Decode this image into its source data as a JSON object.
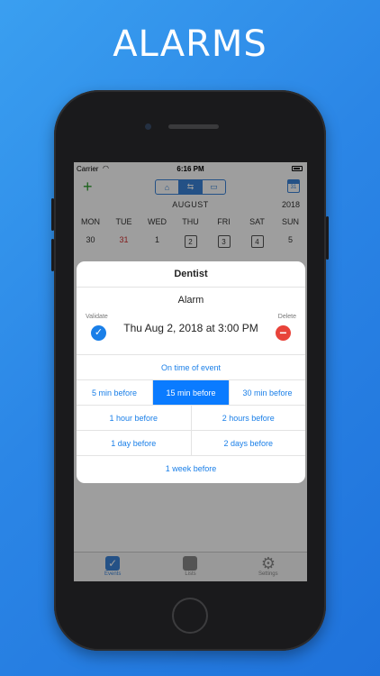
{
  "headline": "ALARMS",
  "status_bar": {
    "carrier": "Carrier",
    "time": "6:16 PM"
  },
  "nav": {
    "add_label": "+",
    "calendar_day": "31"
  },
  "calendar": {
    "month": "AUGUST",
    "year": "2018",
    "day_names": [
      "MON",
      "TUE",
      "WED",
      "THU",
      "FRI",
      "SAT",
      "SUN"
    ],
    "day_numbers": [
      "30",
      "31",
      "1",
      "2",
      "3",
      "4",
      "5"
    ]
  },
  "tabbar": {
    "events_label": "Events",
    "lists_label": "Lists",
    "settings_label": "Settings"
  },
  "modal": {
    "title": "Dentist",
    "subtitle": "Alarm",
    "validate_label": "Validate",
    "delete_label": "Delete",
    "datetime": "Thu Aug 2, 2018 at 3:00 PM",
    "options": {
      "on_time": "On time of event",
      "min5": "5 min before",
      "min15": "15 min before",
      "min30": "30 min before",
      "hour1": "1 hour before",
      "hours2": "2 hours before",
      "day1": "1 day before",
      "days2": "2 days before",
      "week1": "1 week before"
    },
    "selected_option": "15 min before"
  },
  "colors": {
    "accent": "#0a7bff",
    "delete": "#e8433a",
    "add": "#2ea12e",
    "background": "#2b86e6"
  }
}
